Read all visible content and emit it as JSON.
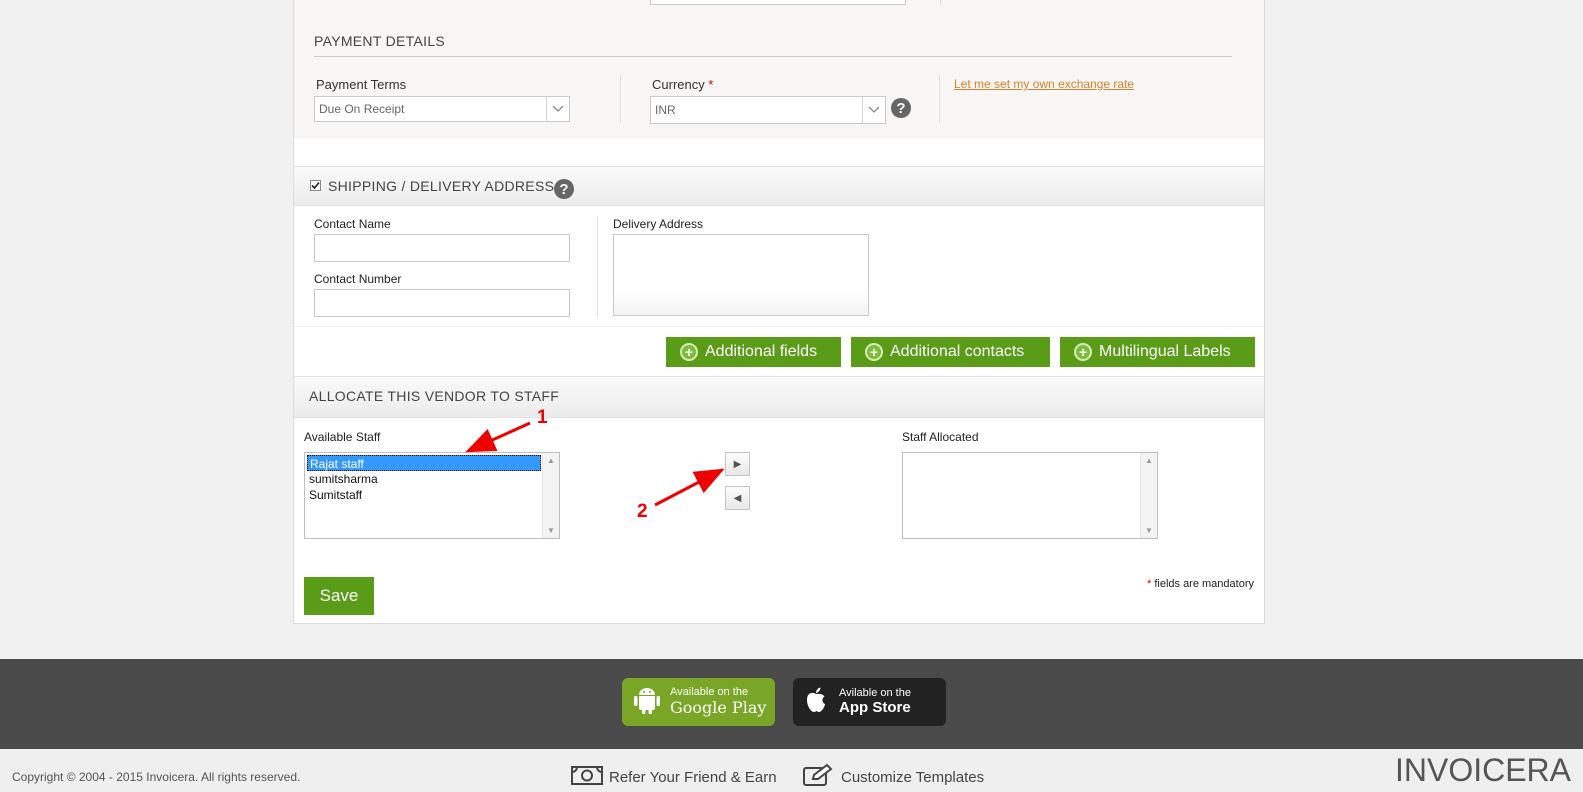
{
  "payment": {
    "section_title": "PAYMENT DETAILS",
    "terms_label": "Payment Terms",
    "terms_value": "Due On Receipt",
    "currency_label": "Currency",
    "required_mark": "*",
    "currency_value": "INR",
    "help_glyph": "?",
    "exchange_link": "Let me set my own exchange rate"
  },
  "shipping": {
    "section_title": "SHIPPING / DELIVERY ADDRESS",
    "checked": true,
    "help_glyph": "?",
    "contact_name_label": "Contact Name",
    "contact_number_label": "Contact Number",
    "delivery_address_label": "Delivery Address"
  },
  "actions": {
    "plus_glyph": "+",
    "additional_fields": "Additional fields",
    "additional_contacts": "Additional contacts",
    "multilingual_labels": "Multilingual Labels"
  },
  "staff": {
    "section_title": "ALLOCATE THIS VENDOR TO STAFF",
    "available_label": "Available Staff",
    "available": [
      "Rajat staff",
      "sumitsharma",
      "Sumitstaff"
    ],
    "selected_index": 0,
    "allocated_label": "Staff Allocated",
    "allocated": [],
    "move_right_glyph": "▶",
    "move_left_glyph": "◀"
  },
  "form": {
    "save_label": "Save",
    "mandatory_mark": "*",
    "mandatory_note": "fields are mandatory"
  },
  "annotations": {
    "arrow1": "1",
    "arrow2": "2",
    "color": "#e00000"
  },
  "footer": {
    "google_small": "Available on the",
    "google_big": "Google Play",
    "apple_small": "Avilable on the",
    "apple_big": "App Store",
    "copyright": "Copyright © 2004 - 2015 Invoicera. All rights reserved.",
    "refer": "Refer Your Friend & Earn",
    "customize": "Customize Templates",
    "logo": "INVOICERA"
  },
  "colors": {
    "green": "#5a9b17",
    "link": "#d9822b",
    "footer_bg": "#4a4a4a",
    "select_blue": "#3399ff"
  }
}
